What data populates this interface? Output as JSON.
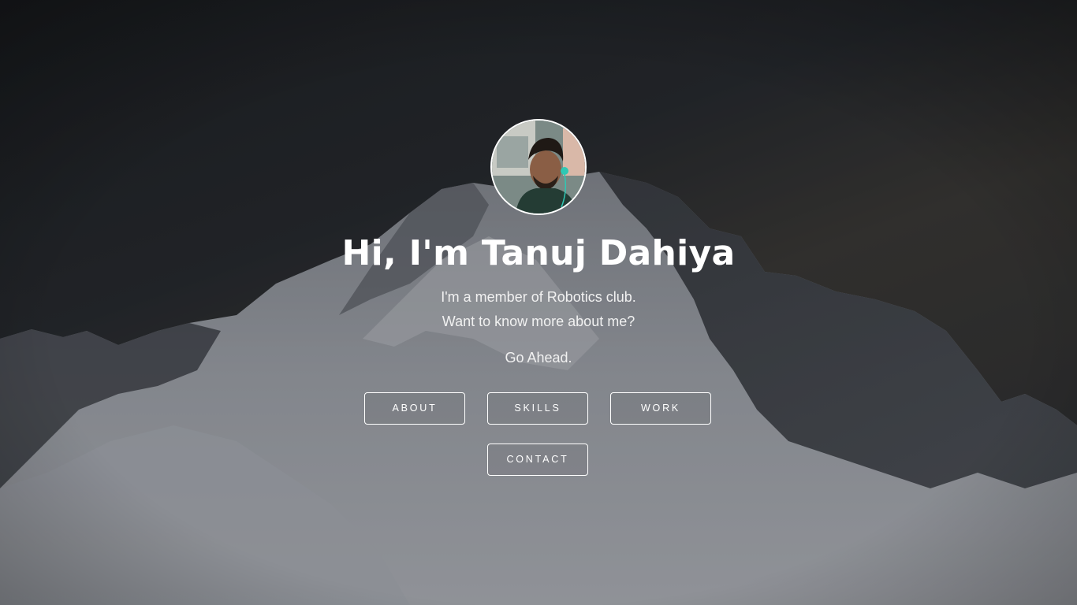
{
  "hero": {
    "avatar_alt": "Tanuj Dahiya",
    "headline": "Hi, I'm Tanuj Dahiya",
    "tagline_1": "I'm a member of Robotics club.",
    "tagline_2": "Want to know more about me?",
    "tagline_3": "Go Ahead."
  },
  "nav": {
    "about_label": "ABOUT",
    "skills_label": "SKILLS",
    "work_label": "WORK",
    "contact_label": "CONTACT"
  },
  "colors": {
    "text": "#ffffff",
    "sky_dark": "#1b1d20",
    "snow": "#c9cbd0"
  }
}
